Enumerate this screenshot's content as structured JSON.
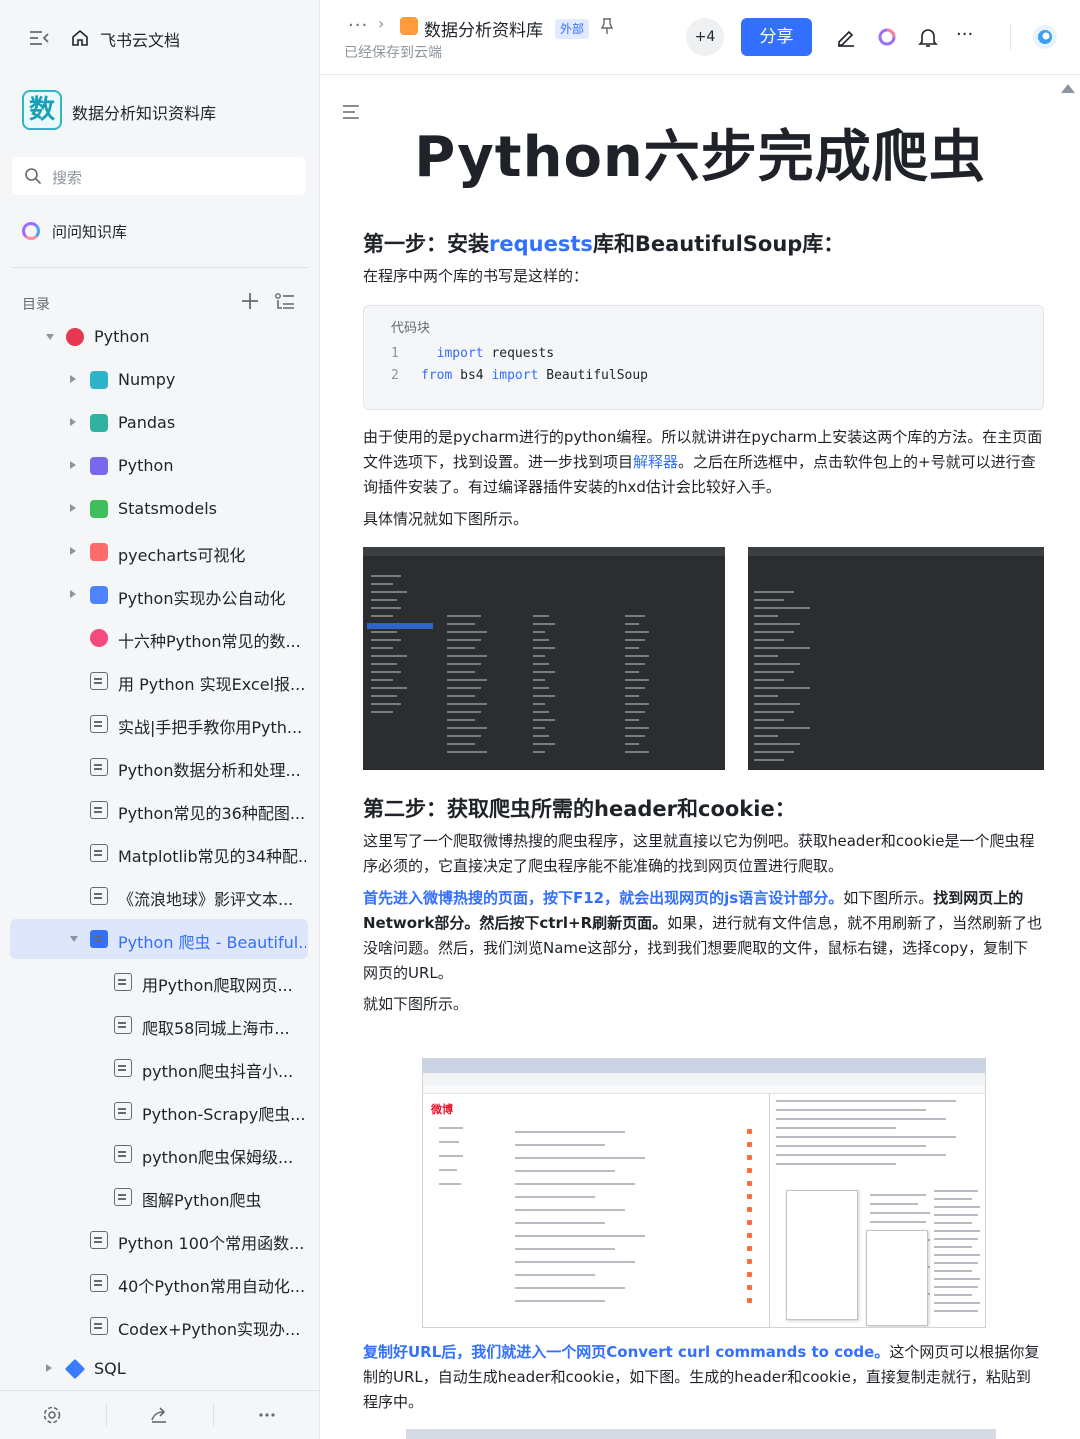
{
  "sidebar": {
    "app_title": "飞书云文档",
    "library": {
      "avatar_char": "数",
      "name": "数据分析知识资料库"
    },
    "search_placeholder": "搜索",
    "ask_label": "问问知识库",
    "toc_heading": "目录",
    "tree": [
      {
        "label": "Python",
        "level": 0,
        "arrow": "down",
        "icon": "emoji-100-icon",
        "color": "#e8384f"
      },
      {
        "label": "Numpy",
        "level": 1,
        "arrow": "right",
        "icon": "sheet-icon",
        "color": "#2fb3c9"
      },
      {
        "label": "Pandas",
        "level": 1,
        "arrow": "right",
        "icon": "sheet-icon",
        "color": "#2fb3a0"
      },
      {
        "label": "Python",
        "level": 1,
        "arrow": "right",
        "icon": "board-icon",
        "color": "#7b67ee"
      },
      {
        "label": "Statsmodels",
        "level": 1,
        "arrow": "right",
        "icon": "sheet-icon",
        "color": "#3fbf5b"
      },
      {
        "label": "pyecharts可视化",
        "level": 1,
        "arrow": "right",
        "icon": "app-icon",
        "color": "#ff6b6b"
      },
      {
        "label": "Python实现办公自动化",
        "level": 1,
        "arrow": "right",
        "icon": "chart-icon",
        "color": "#4e83fd"
      },
      {
        "label": "十六种Python常见的数...",
        "level": 1,
        "arrow": "",
        "icon": "flower-icon",
        "color": "#f54a7c"
      },
      {
        "label": "用 Python 实现Excel报...",
        "level": 1,
        "arrow": "",
        "icon": "doc-icon",
        "color": ""
      },
      {
        "label": "实战|手把手教你用Pyth...",
        "level": 1,
        "arrow": "",
        "icon": "doc-icon",
        "color": ""
      },
      {
        "label": "Python数据分析和处理...",
        "level": 1,
        "arrow": "",
        "icon": "doc-icon",
        "color": ""
      },
      {
        "label": "Python常见的36种配图...",
        "level": 1,
        "arrow": "",
        "icon": "doc-icon",
        "color": ""
      },
      {
        "label": "Matplotlib常见的34种配...",
        "level": 1,
        "arrow": "",
        "icon": "doc-icon",
        "color": ""
      },
      {
        "label": "《流浪地球》影评文本...",
        "level": 1,
        "arrow": "",
        "icon": "doc-icon",
        "color": ""
      },
      {
        "label": "Python 爬虫 - Beautiful...",
        "level": 1,
        "arrow": "down",
        "icon": "doc-icon-active",
        "color": "#3370ff",
        "active": true
      },
      {
        "label": "用Python爬取网页...",
        "level": 2,
        "arrow": "",
        "icon": "doc-icon",
        "color": ""
      },
      {
        "label": "爬取58同城上海市...",
        "level": 2,
        "arrow": "",
        "icon": "doc-icon",
        "color": ""
      },
      {
        "label": "python爬虫抖音小...",
        "level": 2,
        "arrow": "",
        "icon": "doc-icon",
        "color": ""
      },
      {
        "label": "Python-Scrapy爬虫...",
        "level": 2,
        "arrow": "",
        "icon": "doc-icon",
        "color": ""
      },
      {
        "label": "python爬虫保姆级...",
        "level": 2,
        "arrow": "",
        "icon": "doc-icon",
        "color": ""
      },
      {
        "label": "图解Python爬虫",
        "level": 2,
        "arrow": "",
        "icon": "doc-icon",
        "color": ""
      },
      {
        "label": "Python 100个常用函数...",
        "level": 1,
        "arrow": "",
        "icon": "doc-icon",
        "color": ""
      },
      {
        "label": "40个Python常用自动化...",
        "level": 1,
        "arrow": "",
        "icon": "doc-icon",
        "color": ""
      },
      {
        "label": "Codex+Python实现办...",
        "level": 1,
        "arrow": "",
        "icon": "doc-icon",
        "color": ""
      },
      {
        "label": "SQL",
        "level": 0,
        "arrow": "right",
        "icon": "diamond-icon",
        "color": "#3b7cff"
      }
    ]
  },
  "header": {
    "breadcrumb_more": "···",
    "breadcrumb_sep": "›",
    "doc_title": "数据分析资料库",
    "badge": "外部",
    "saved_status": "已经保存到云端",
    "collaborators_more": "+4",
    "share_label": "分享",
    "more_label": "···"
  },
  "doc": {
    "title": "Python六步完成爬虫",
    "step1": {
      "h_pre": "第一步：安装",
      "h_link": "requests",
      "h_post": "库和BeautifulSoup库：",
      "intro": "在程序中两个库的书写是这样的：",
      "code_caption": "代码块",
      "code": [
        {
          "n": "1",
          "kw": "import",
          "rest": " requests",
          "pre": "  "
        },
        {
          "n": "2",
          "kw": "from",
          "rest": " bs4 ",
          "kw2": "import",
          "rest2": " BeautifulSoup",
          "pre": ""
        }
      ],
      "p1_a": "由于使用的是pycharm进行的python编程。所以就讲讲在pycharm上安装这两个库的方法。在主页面文件选项下，找到设置。进一步找到项目",
      "p1_link": "解释器",
      "p1_b": "。之后在所选框中，点击软件包上的+号就可以进行查询插件安装了。有过编译器插件安装的hxd估计会比较好入手。",
      "p2": "具体情况就如下图所示。"
    },
    "step2": {
      "heading": "第二步：获取爬虫所需的header和cookie：",
      "p1": "这里写了一个爬取微博热搜的爬虫程序，这里就直接以它为例吧。获取header和cookie是一个爬虫程序必须的，它直接决定了爬虫程序能不能准确的找到网页位置进行爬取。",
      "p2_blue": "首先进入微博热搜的页面，按下F12，就会出现网页的js语言设计部分。",
      "p2_a": "如下图所示。",
      "p2_bold": "找到网页上的Network部分。然后按下ctrl+R刷新页面。",
      "p2_b": "如果，进行就有文件信息，就不用刷新了，当然刷新了也没啥问题。然后，我们浏览Name这部分，找到我们想要爬取的文件，鼠标右键，选择copy，复制下网页的URL。",
      "p3": "就如下图所示。",
      "p4_blue": "复制好URL后，我们就进入一个网页Convert curl commands to code。",
      "p4_a": "这个网页可以根据你复制的URL，自动生成header和cookie，如下图。生成的header和cookie，直接复制走就行，粘贴到程序中。"
    },
    "screenshot_weibo_logo": "微博"
  },
  "colors": {
    "accent": "#3370ff",
    "sidebar_bg": "#f5f6f7",
    "active_bg": "#dde6fb"
  }
}
